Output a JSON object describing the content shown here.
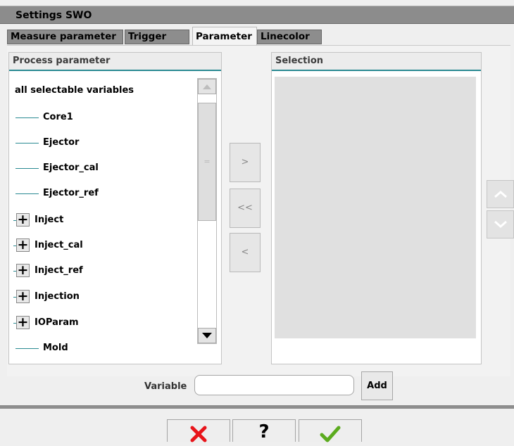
{
  "window": {
    "title": "Settings SWO"
  },
  "tabs": [
    {
      "label": "Measure parameter"
    },
    {
      "label": "Trigger"
    },
    {
      "label": "Parameter",
      "active": true
    },
    {
      "label": "Linecolor"
    }
  ],
  "left_panel": {
    "header": "Process parameter",
    "all_label": "all selectable variables",
    "items": [
      {
        "label": "Core1",
        "expandable": false
      },
      {
        "label": "Ejector",
        "expandable": false
      },
      {
        "label": "Ejector_cal",
        "expandable": false
      },
      {
        "label": "Ejector_ref",
        "expandable": false
      },
      {
        "label": "Inject",
        "expandable": true
      },
      {
        "label": "Inject_cal",
        "expandable": true
      },
      {
        "label": "Inject_ref",
        "expandable": true
      },
      {
        "label": "Injection",
        "expandable": true
      },
      {
        "label": "IOParam",
        "expandable": true
      },
      {
        "label": "Mold",
        "expandable": false
      }
    ]
  },
  "right_panel": {
    "header": "Selection"
  },
  "transfer_buttons": {
    "add_one": ">",
    "remove_all": "<<",
    "remove_one": "<"
  },
  "variable": {
    "label": "Variable",
    "value": "",
    "add_label": "Add"
  },
  "footer": {
    "cancel_icon": "red-x-icon",
    "help_label": "?",
    "ok_icon": "green-check-icon"
  },
  "colors": {
    "accent": "#2a8a92",
    "cancel": "#e8141a",
    "ok": "#5bab1e",
    "titlebar": "#8c8c8c"
  }
}
